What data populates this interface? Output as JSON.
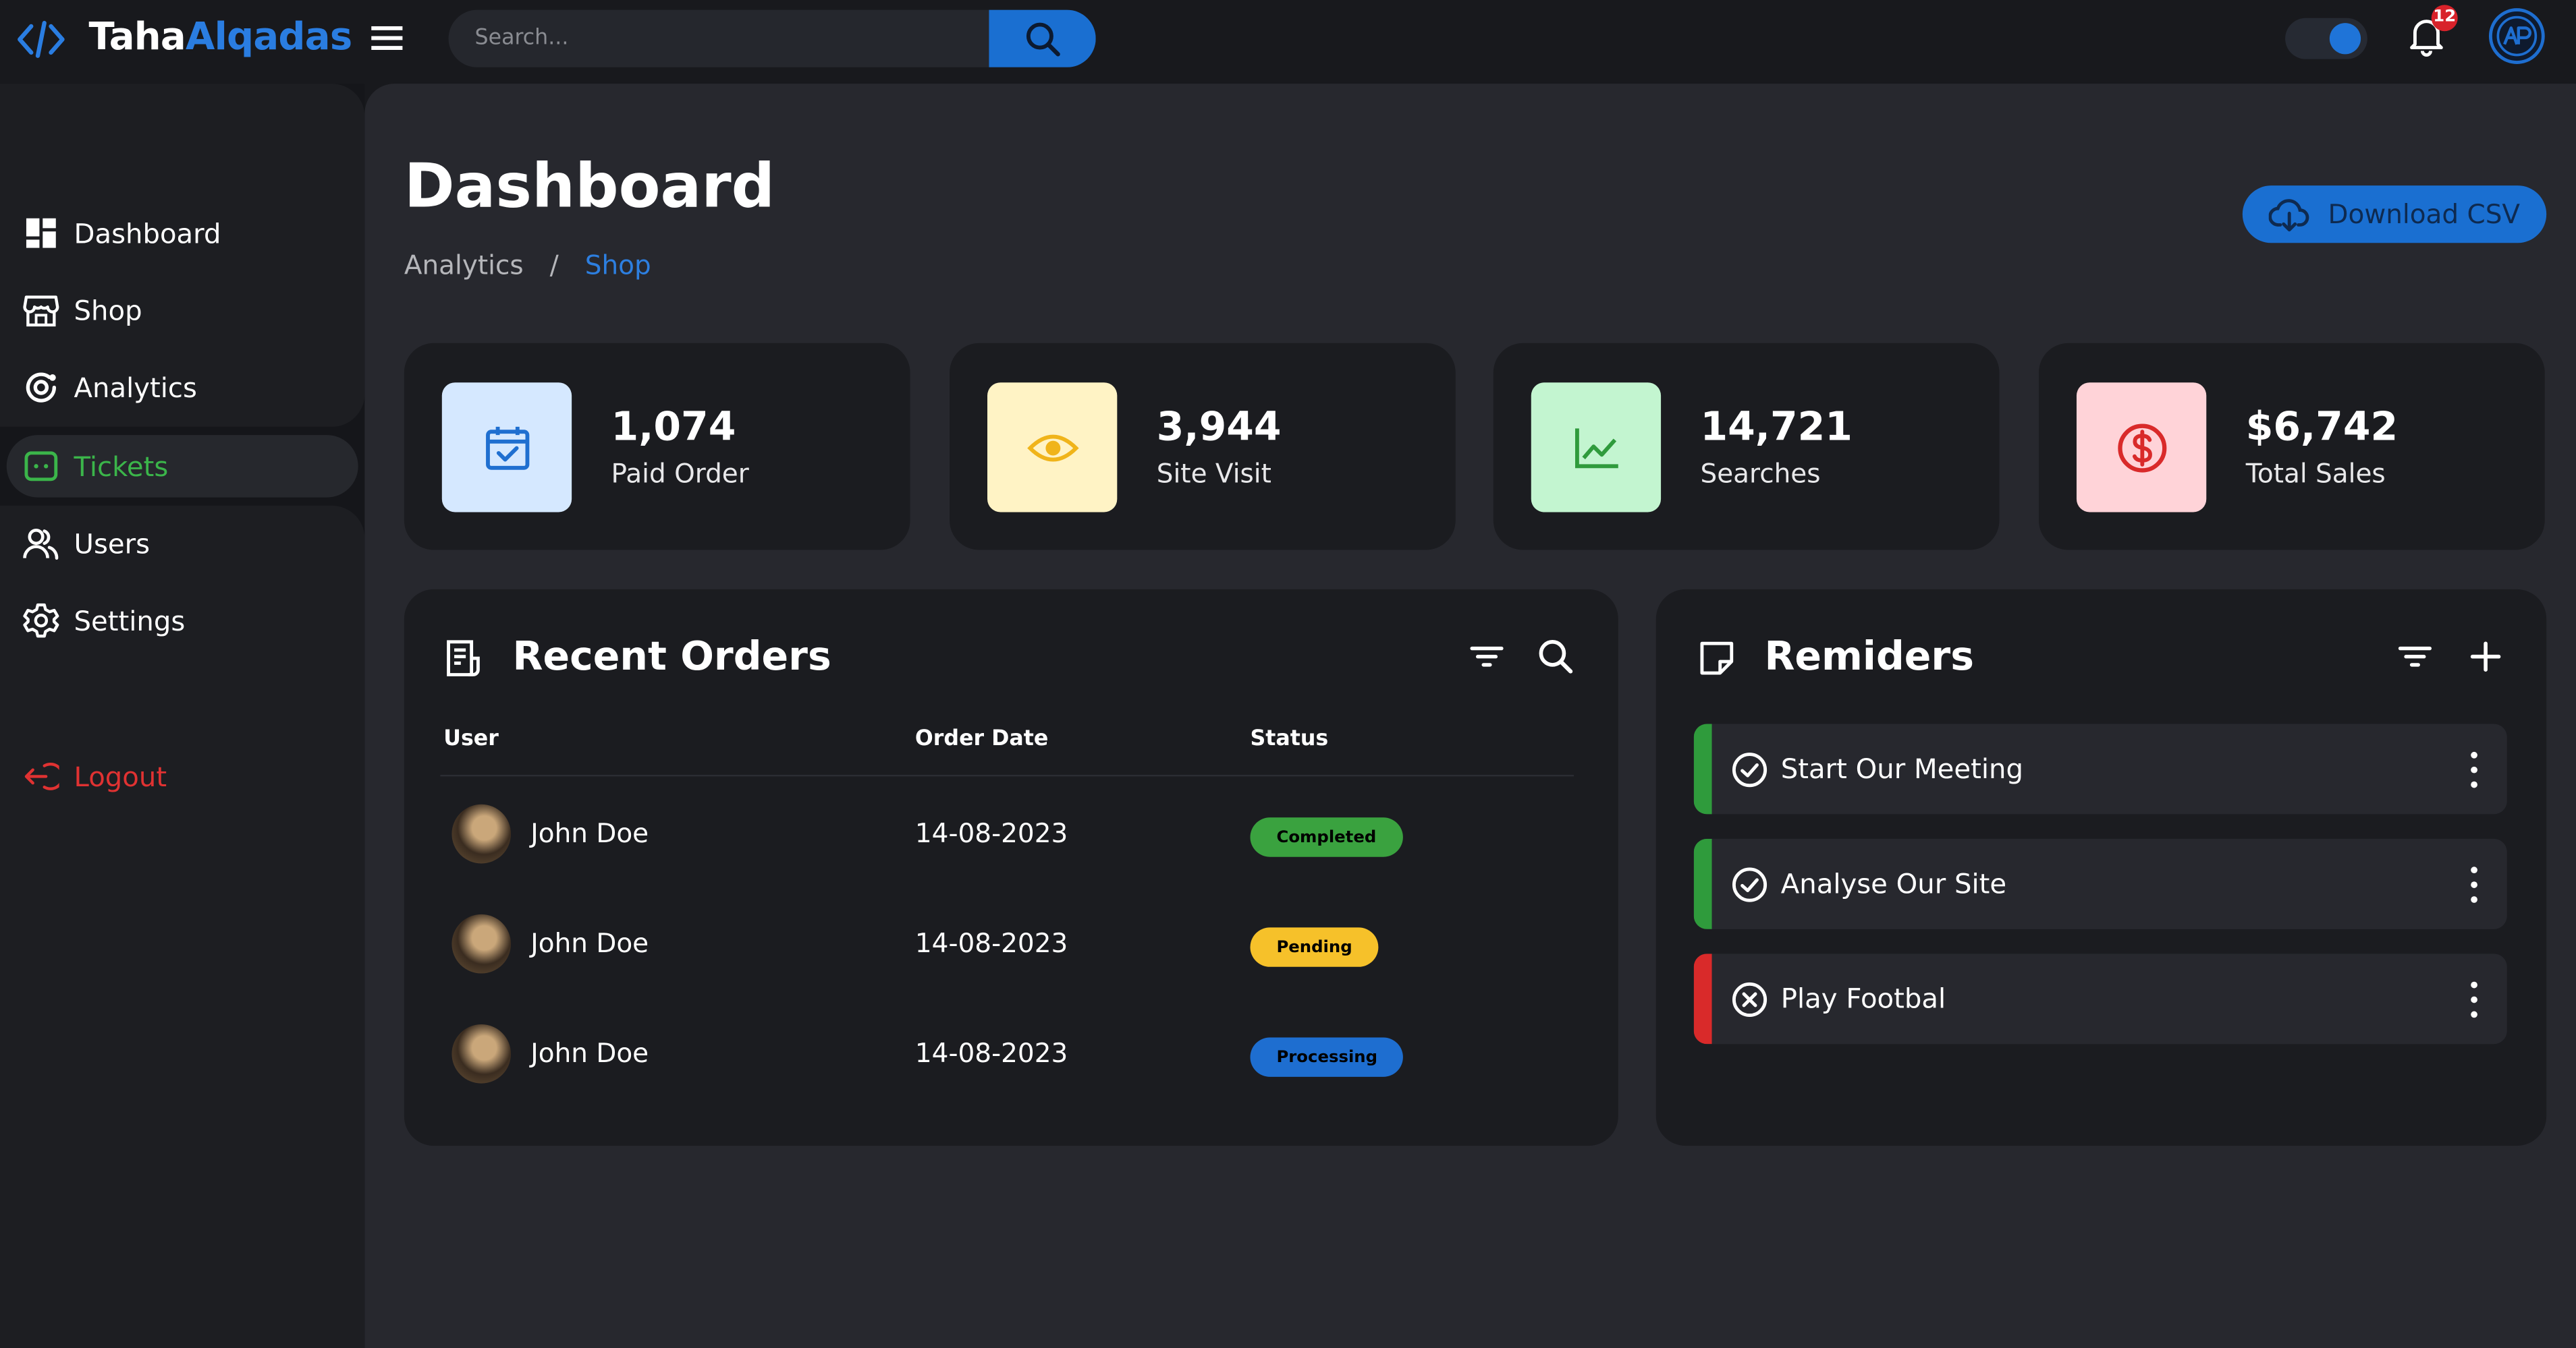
{
  "header": {
    "brand_part1": "Taha",
    "brand_part2": "Alqadas",
    "search_placeholder": "Search...",
    "notification_count": "12",
    "theme_toggle_on": true
  },
  "sidebar": {
    "items": [
      {
        "label": "Dashboard",
        "icon": "dashboard-icon"
      },
      {
        "label": "Shop",
        "icon": "shop-icon"
      },
      {
        "label": "Analytics",
        "icon": "analytics-icon"
      },
      {
        "label": "Tickets",
        "icon": "ticket-icon",
        "active": true
      },
      {
        "label": "Users",
        "icon": "users-icon"
      },
      {
        "label": "Settings",
        "icon": "gear-icon"
      }
    ],
    "logout_label": "Logout"
  },
  "page": {
    "title": "Dashboard",
    "breadcrumb": [
      "Analytics",
      "Shop"
    ],
    "download_label": "Download CSV"
  },
  "stats": [
    {
      "value": "1,074",
      "label": "Paid Order",
      "icon": "calendar-check-icon",
      "color": "#1f6fd0",
      "bg": "#d5e8ff"
    },
    {
      "value": "3,944",
      "label": "Site Visit",
      "icon": "eye-icon",
      "color": "#f0b41a",
      "bg": "#fff3c5"
    },
    {
      "value": "14,721",
      "label": "Searches",
      "icon": "line-chart-icon",
      "color": "#2f9b3c",
      "bg": "#c3f5d0"
    },
    {
      "value": "$6,742",
      "label": "Total Sales",
      "icon": "dollar-icon",
      "color": "#d92a2a",
      "bg": "#ffd3d8"
    }
  ],
  "orders": {
    "title": "Recent Orders",
    "columns": [
      "User",
      "Order Date",
      "Status"
    ],
    "rows": [
      {
        "user": "John Doe",
        "date": "14-08-2023",
        "status": "Completed",
        "status_color": "#3aa23f"
      },
      {
        "user": "John Doe",
        "date": "14-08-2023",
        "status": "Pending",
        "status_color": "#f6c12a"
      },
      {
        "user": "John Doe",
        "date": "14-08-2023",
        "status": "Processing",
        "status_color": "#1e6ed0"
      }
    ]
  },
  "reminders": {
    "title": "Remiders",
    "items": [
      {
        "text": "Start Our Meeting",
        "state": "done",
        "color": "#2f9b3c"
      },
      {
        "text": "Analyse Our Site",
        "state": "done",
        "color": "#2f9b3c"
      },
      {
        "text": "Play Footbal",
        "state": "cancelled",
        "color": "#d92a2a"
      }
    ]
  }
}
